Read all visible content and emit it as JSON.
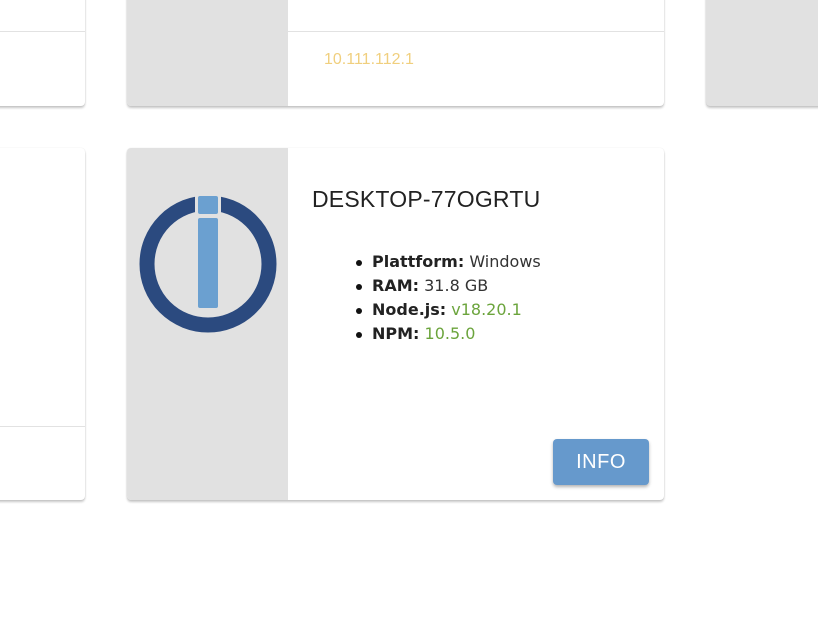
{
  "top_card": {
    "ip_address": "10.111.112.1"
  },
  "host_card": {
    "title": "DESKTOP-77OGRTU",
    "logo_icon": "iobroker-logo-icon",
    "specs": [
      {
        "label": "Plattform:",
        "value": "Windows"
      },
      {
        "label": "RAM:",
        "value": "31.8 GB"
      },
      {
        "label": "Node.js:",
        "value": "v18.20.1"
      },
      {
        "label": "NPM:",
        "value": "10.5.0"
      }
    ],
    "info_button_label": "INFO"
  },
  "colors": {
    "accent_button": "#6699cc",
    "version_green": "#6ba43c",
    "ip_yellow": "#f0cf7e",
    "logo_ring": "#2b4a7f",
    "logo_bar": "#6ba0d0",
    "side_panel": "#e1e1e1"
  }
}
